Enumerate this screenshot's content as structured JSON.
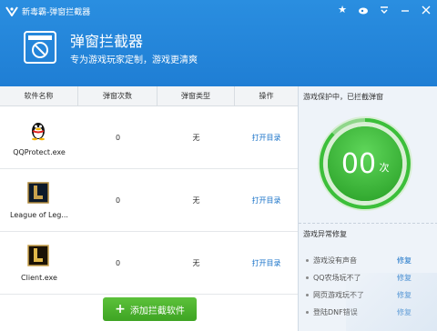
{
  "titlebar": {
    "app_title": "新毒霸-弹窗拦截器",
    "icons": [
      "star-icon",
      "weibo-icon",
      "menu-icon",
      "minimize-icon",
      "close-icon"
    ]
  },
  "banner": {
    "title": "弹窗拦截器",
    "subtitle": "专为游戏玩家定制，游戏更清爽"
  },
  "table": {
    "headers": [
      "软件名称",
      "弹窗次数",
      "弹窗类型",
      "操作"
    ],
    "rows": [
      {
        "name": "QQProtect.exe",
        "count": "0",
        "type": "无",
        "action": "打开目录",
        "icon": "qq-penguin-icon"
      },
      {
        "name": "League of Leg...",
        "count": "0",
        "type": "无",
        "action": "打开目录",
        "icon": "league-of-legends-icon"
      },
      {
        "name": "Client.exe",
        "count": "0",
        "type": "无",
        "action": "打开目录",
        "icon": "lol-client-icon"
      }
    ]
  },
  "add_button": {
    "label": "添加拦截软件"
  },
  "protect": {
    "title": "游戏保护中，已拦截弹窗",
    "count": "00",
    "unit": "次"
  },
  "repair": {
    "title": "游戏异常修复",
    "items": [
      {
        "text": "游戏没有声音",
        "action": "修复"
      },
      {
        "text": "QQ农场玩不了",
        "action": "修复"
      },
      {
        "text": "网页游戏玩不了",
        "action": "修复"
      },
      {
        "text": "登陆DNF错误",
        "action": "修复"
      }
    ]
  },
  "colors": {
    "header": "#1f7ed4",
    "gauge": "#3cbf3a",
    "link": "#1a73c8",
    "button": "#4cb22d"
  }
}
